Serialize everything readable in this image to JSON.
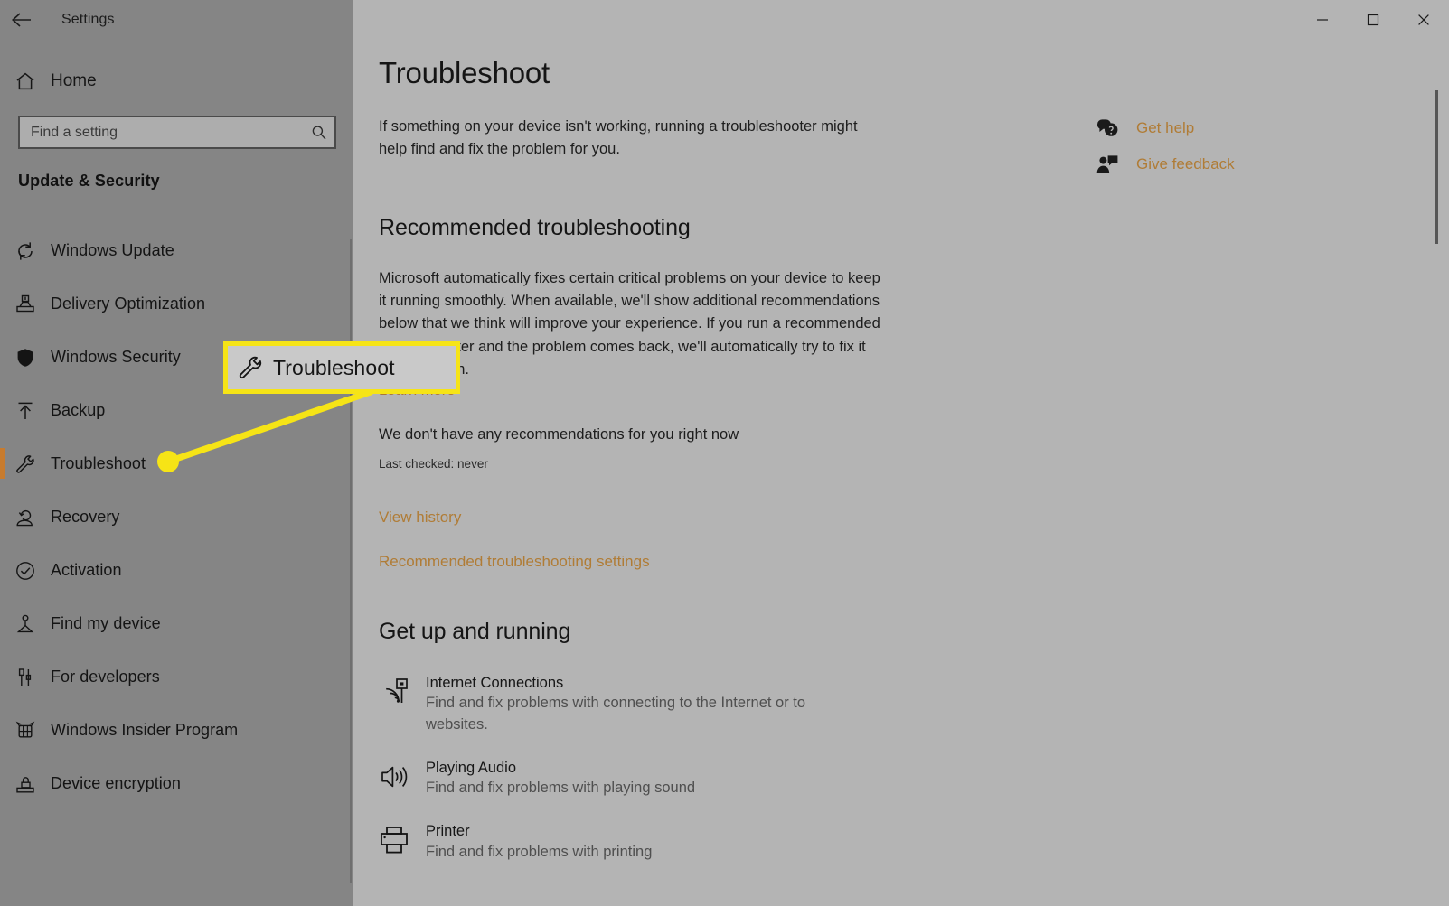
{
  "window": {
    "app_title": "Settings",
    "back_icon": "back-arrow-icon",
    "controls": {
      "minimize": "minimize-icon",
      "maximize": "maximize-icon",
      "close": "close-icon"
    }
  },
  "sidebar": {
    "home_label": "Home",
    "home_icon": "home-icon",
    "search": {
      "placeholder": "Find a setting",
      "value": "",
      "icon": "search-icon"
    },
    "category_title": "Update & Security",
    "items": [
      {
        "label": "Windows Update",
        "icon": "sync-icon",
        "selected": false
      },
      {
        "label": "Delivery Optimization",
        "icon": "delivery-icon",
        "selected": false
      },
      {
        "label": "Windows Security",
        "icon": "shield-icon",
        "selected": false
      },
      {
        "label": "Backup",
        "icon": "upload-arrow-icon",
        "selected": false
      },
      {
        "label": "Troubleshoot",
        "icon": "wrench-icon",
        "selected": true
      },
      {
        "label": "Recovery",
        "icon": "recovery-icon",
        "selected": false
      },
      {
        "label": "Activation",
        "icon": "check-circle-icon",
        "selected": false
      },
      {
        "label": "Find my device",
        "icon": "find-device-icon",
        "selected": false
      },
      {
        "label": "For developers",
        "icon": "tools-icon",
        "selected": false
      },
      {
        "label": "Windows Insider Program",
        "icon": "insider-bug-icon",
        "selected": false
      },
      {
        "label": "Device encryption",
        "icon": "lock-drive-icon",
        "selected": false
      }
    ]
  },
  "main": {
    "page_title": "Troubleshoot",
    "intro": "If something on your device isn't working, running a troubleshooter might help find and fix the problem for you.",
    "recommended": {
      "heading": "Recommended troubleshooting",
      "body": "Microsoft automatically fixes certain critical problems on your device to keep it running smoothly. When available, we'll show additional recommendations below that we think will improve your experience. If you run a recommended troubleshooter and the problem comes back, we'll automatically try to fix it for you again.",
      "learn_more": "Learn more",
      "no_recommendations": "We don't have any recommendations for you right now",
      "last_checked": "Last checked: never",
      "view_history_link": "View history",
      "settings_link": "Recommended troubleshooting settings"
    },
    "get_up_and_running": {
      "heading": "Get up and running",
      "items": [
        {
          "name": "Internet Connections",
          "description": "Find and fix problems with connecting to the Internet or to websites.",
          "icon": "wifi-signal-icon"
        },
        {
          "name": "Playing Audio",
          "description": "Find and fix problems with playing sound",
          "icon": "speaker-icon"
        },
        {
          "name": "Printer",
          "description": "Find and fix problems with printing",
          "icon": "printer-icon"
        }
      ]
    },
    "help": {
      "get_help": "Get help",
      "get_help_icon": "question-bubble-icon",
      "give_feedback": "Give feedback",
      "give_feedback_icon": "feedback-person-icon"
    }
  },
  "callout": {
    "label": "Troubleshoot",
    "icon": "wrench-icon",
    "border_color": "#f6e416",
    "fill_color": "#c9c9c9"
  },
  "colors": {
    "sidebar_bg": "#858585",
    "content_bg": "#b4b4b4",
    "accent_selected": "#c77b2e",
    "link": "#b07c36",
    "highlight_yellow": "#f6e416"
  }
}
